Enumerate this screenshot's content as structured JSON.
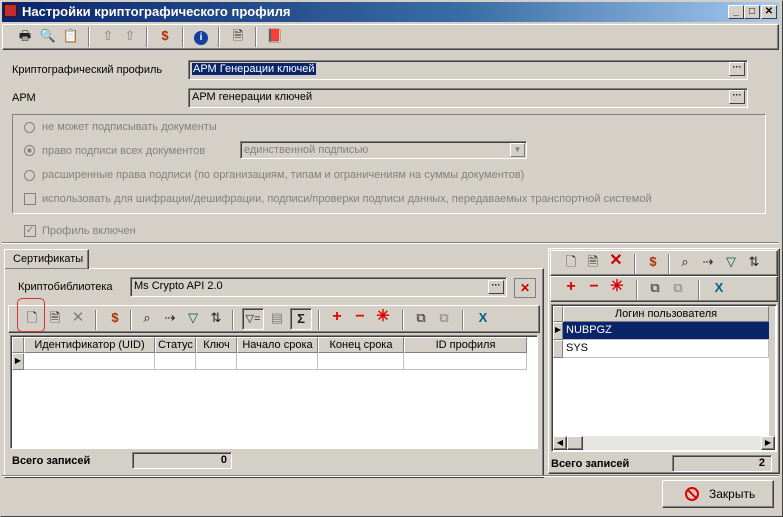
{
  "window": {
    "title": "Настройки криптографического профиля",
    "min_label": "_",
    "max_label": "□",
    "close_label": "✕"
  },
  "form": {
    "profile_label": "Криптографический профиль",
    "profile_value": "АРМ Генерации ключей",
    "arm_label": "АРМ",
    "arm_value": "АРМ генерации ключей",
    "opt_cannot_sign": "не может подписывать документы",
    "opt_sign_all": "право подписи всех документов",
    "sign_mode_value": "единственной подписью",
    "opt_extended": "расширенные права подписи (по организациям, типам и ограничениям на суммы документов)",
    "chk_encrypt": "использовать для шифрации/дешифрации, подписи/проверки подписи данных, передаваемых транспортной системой",
    "chk_profile_enabled": "Профиль включен"
  },
  "certs": {
    "tab_label": "Сертификаты",
    "cryptolib_label": "Криптобиблиотека",
    "cryptolib_value": "Ms Crypto API 2.0",
    "columns": [
      "Идентификатор (UID)",
      "Статус",
      "Ключ",
      "Начало срока",
      "Конец срока",
      "ID профиля"
    ],
    "total_label": "Всего записей",
    "total_value": "0"
  },
  "users": {
    "column": "Логин пользователя",
    "rows": [
      "NUBPGZ",
      "SYS"
    ],
    "total_label": "Всего записей",
    "total_value": "2"
  },
  "footer": {
    "close_label": "Закрыть"
  },
  "colors": {
    "title_bg": "#0a246a",
    "selection": "#0a246a",
    "highlight_box": "#e03030"
  }
}
